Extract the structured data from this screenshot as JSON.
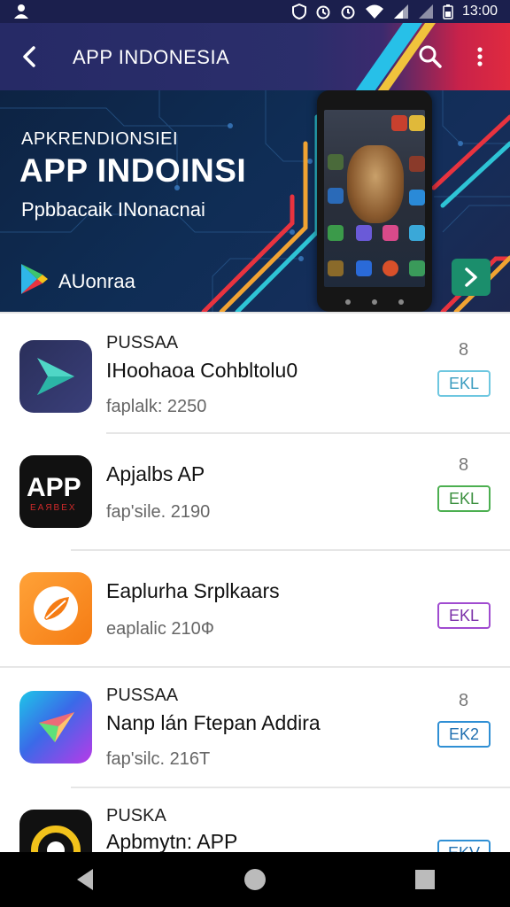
{
  "status": {
    "time": "13:00"
  },
  "appbar": {
    "title": "APP INDONESIA"
  },
  "banner": {
    "eyebrow": "APKRENDIONSIEI",
    "headline": "APP INDOINSI",
    "subtitle": "Ppbbacaik INonacnai",
    "brand": "AUonraa"
  },
  "apps": [
    {
      "label": "PUSSAA",
      "name": "IHoohaoa Cohbltolu0",
      "meta": "faplalk: 2250",
      "count": "8",
      "button": "EKL",
      "button_color": "#6ec7e0"
    },
    {
      "label": "",
      "name": "Apjalbs AP",
      "meta": "fap'sile. 2190",
      "count": "8",
      "button": "EKL",
      "button_color": "#4caf50",
      "icon_text": "APP",
      "icon_sub": "ЕАЯВЕХ"
    },
    {
      "label": "",
      "name": "Eaplurha Srplkaars",
      "meta": "eaplalic 210Ф",
      "count": "",
      "button": "EKL",
      "button_color": "#a04bd0"
    },
    {
      "label": "PUSSAA",
      "name": "Nanp lán Ftepan Addira",
      "meta": "fap'silc. 216Т",
      "count": "8",
      "button": "EK2",
      "button_color": "#2f8fd4"
    },
    {
      "label": "PUSKA",
      "name": "Apbmytn: APP",
      "meta": "",
      "count": "",
      "button": "EKV",
      "button_color": "#2f8fd4"
    }
  ],
  "colors": {
    "statusbar": "#1b1f4d",
    "appbar_left": "#262a66",
    "appbar_right": "#e02a3f",
    "banner": "#0f2d55",
    "cta": "#1b8e6c"
  }
}
